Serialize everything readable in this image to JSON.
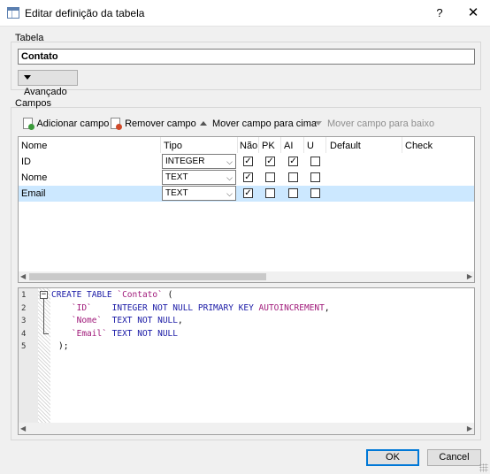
{
  "window": {
    "title": "Editar definição da tabela",
    "help_label": "?",
    "close_label": "✕"
  },
  "table_group": {
    "label": "Tabela",
    "name_value": "Contato",
    "advanced_label": "Avançado"
  },
  "fields_group": {
    "label": "Campos",
    "toolbar": {
      "add_label": "Adicionar campo",
      "remove_label": "Remover campo",
      "move_up_label": "Mover campo para cima",
      "move_down_label": "Mover campo para baixo"
    },
    "columns": [
      "Nome",
      "Tipo",
      "Não",
      "PK",
      "AI",
      "U",
      "Default",
      "Check"
    ],
    "rows": [
      {
        "name": "ID",
        "type": "INTEGER",
        "not_null": true,
        "pk": true,
        "ai": true,
        "unique": false,
        "selected": false
      },
      {
        "name": "Nome",
        "type": "TEXT",
        "not_null": true,
        "pk": false,
        "ai": false,
        "unique": false,
        "selected": false
      },
      {
        "name": "Email",
        "type": "TEXT",
        "not_null": true,
        "pk": false,
        "ai": false,
        "unique": false,
        "selected": true
      }
    ]
  },
  "sql": {
    "line_numbers": [
      "1",
      "2",
      "3",
      "4",
      "5"
    ],
    "lines": [
      [
        {
          "t": "CREATE TABLE ",
          "c": "kw"
        },
        {
          "t": "`Contato`",
          "c": "ident"
        },
        {
          "t": " (",
          "c": "punct"
        }
      ],
      [
        {
          "t": "    `ID`",
          "c": "ident"
        },
        {
          "t": "    INTEGER NOT NULL PRIMARY KEY ",
          "c": "kw"
        },
        {
          "t": "AUTOINCREMENT",
          "c": "ident"
        },
        {
          "t": ",",
          "c": "punct"
        }
      ],
      [
        {
          "t": "    `Nome`",
          "c": "ident"
        },
        {
          "t": "  TEXT NOT NULL",
          "c": "kw"
        },
        {
          "t": ",",
          "c": "punct"
        }
      ],
      [
        {
          "t": "    `Email`",
          "c": "ident"
        },
        {
          "t": " TEXT NOT NULL",
          "c": "kw"
        }
      ],
      [
        {
          "t": ");",
          "c": "punct"
        }
      ]
    ],
    "fold_marker": "−"
  },
  "buttons": {
    "ok_label": "OK",
    "cancel_label": "Cancel"
  },
  "icons": {
    "app": "table-icon",
    "add": "add-field-icon",
    "remove": "remove-field-icon",
    "up": "arrow-up-icon",
    "down": "arrow-down-icon"
  },
  "colors": {
    "selected_row": "#cce8ff",
    "sql_keyword": "#1a1aa6",
    "sql_identifier": "#a01a7a",
    "ok_border": "#0078d7"
  }
}
